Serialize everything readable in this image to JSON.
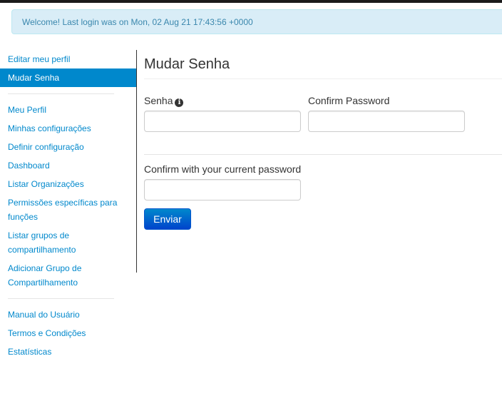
{
  "alert": {
    "text": "Welcome! Last login was on Mon, 02 Aug 21 17:43:56 +0000"
  },
  "sidebar": {
    "group1": [
      "Editar meu perfil",
      "Mudar Senha"
    ],
    "group2": [
      "Meu Perfil",
      "Minhas configurações",
      "Definir configuração",
      "Dashboard",
      "Listar Organizações",
      "Permissões específicas para funções",
      "Listar grupos de compartilhamento",
      "Adicionar Grupo de Compartilhamento"
    ],
    "group3": [
      "Manual do Usuário",
      "Termos e Condições",
      "Estatísticas"
    ],
    "active": "Mudar Senha"
  },
  "form": {
    "title": "Mudar Senha",
    "password_label": "Senha",
    "password_value": "",
    "confirm_label": "Confirm Password",
    "confirm_value": "",
    "current_label": "Confirm with your current password",
    "current_value": "",
    "submit_label": "Enviar"
  },
  "colors": {
    "accent": "#0088cc",
    "alert_bg": "#d9edf7",
    "alert_text": "#3a87ad"
  }
}
